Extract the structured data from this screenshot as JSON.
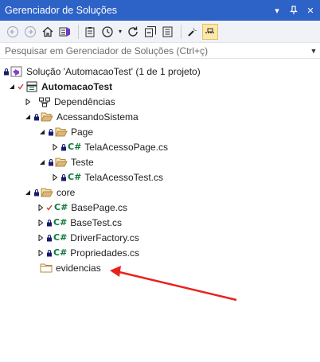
{
  "window": {
    "title": "Gerenciador de Soluções",
    "buttons": [
      "dropdown-icon",
      "pin-icon",
      "close-icon"
    ]
  },
  "toolbar": {
    "icons": [
      "back-icon",
      "forward-icon",
      "home-icon",
      "vs-switch-icon",
      "pending-changes-icon",
      "history-icon",
      "refresh-icon",
      "collapse-all-icon",
      "show-all-files-icon",
      "properties-icon",
      "preview-selected-icon"
    ]
  },
  "search": {
    "placeholder": "Pesquisar em Gerenciador de Soluções (Ctrl+ç)"
  },
  "tree": {
    "solution": "Solução 'AutomacaoTest' (1 de 1 projeto)",
    "project": "AutomacaoTest",
    "dependencies": "Dependências",
    "folder_acessando": "AcessandoSistema",
    "folder_page": "Page",
    "file_tela_page": "TelaAcessoPage.cs",
    "folder_teste": "Teste",
    "file_tela_test": "TelaAcessoTest.cs",
    "folder_core": "core",
    "file_basepage": "BasePage.cs",
    "file_basetest": "BaseTest.cs",
    "file_driverfactory": "DriverFactory.cs",
    "file_propriedades": "Propriedades.cs",
    "folder_evidencias": "evidencias",
    "cs_badge": "C#"
  },
  "colors": {
    "titlebar": "#2d62c7",
    "folder": "#dcb67a",
    "cs": "#0e7a3b",
    "annotation_arrow": "#e8231c",
    "check": "#c0392b"
  }
}
